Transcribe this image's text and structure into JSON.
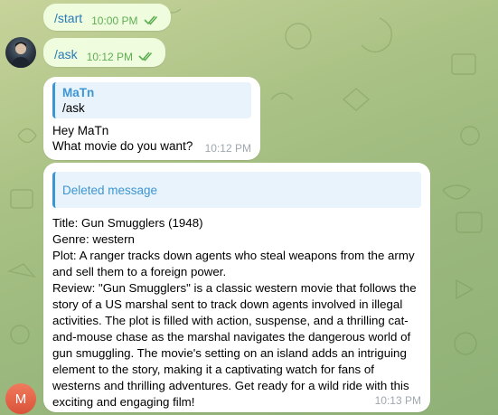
{
  "chat": {
    "outgoing": [
      {
        "text": "/start",
        "time": "10:00 PM"
      },
      {
        "text": "/ask",
        "time": "10:12 PM"
      }
    ],
    "reply_message": {
      "quoted_name": "MaTn",
      "quoted_text": "/ask",
      "line1": "Hey MaTn",
      "line2": "What movie do you want?",
      "time": "10:12 PM"
    },
    "movie_message": {
      "quoted_label": "Deleted message",
      "title": "Title: Gun Smugglers (1948)",
      "genre": "Genre: western",
      "plot_lines": [
        "Plot: A ranger tracks down agents who steal weapons from the army",
        "and sell them to a foreign power."
      ],
      "review_lines": [
        "Review: \"Gun Smugglers\" is a classic western movie that follows the",
        "story of a US marshal sent to track down agents involved in illegal",
        "activities. The plot is filled with action, suspense, and a thrilling cat-",
        "and-mouse chase as the marshal navigates the dangerous world of",
        "gun smuggling. The movie's setting on an island adds an intriguing",
        "element to the story, making it a captivating watch for fans of",
        "westerns and thrilling adventures. Get ready for a wild ride with this",
        "exciting and engaging film!"
      ],
      "time": "10:13 PM"
    },
    "bot_avatar_letter": "M"
  },
  "colors": {
    "accent": "#3d95d3",
    "outgoing_bubble": "#effdde",
    "outgoing_time": "#5fae53",
    "incoming_bubble": "#ffffff"
  }
}
